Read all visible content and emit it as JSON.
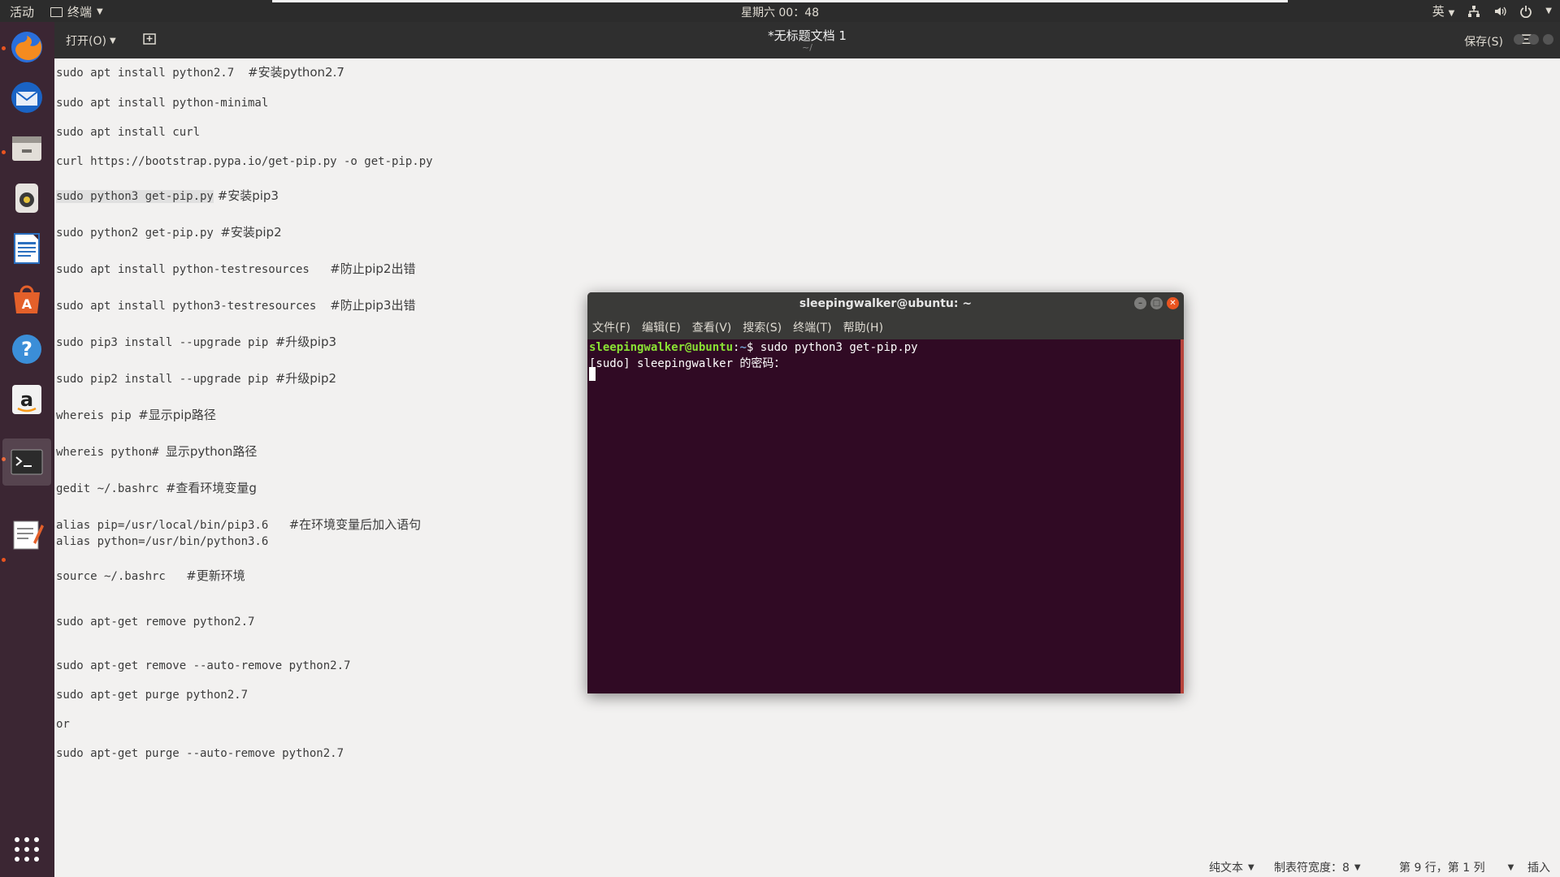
{
  "topbar": {
    "activities": "活动",
    "app_menu": "终端",
    "clock": "星期六 00：48",
    "input_method": "英"
  },
  "gedit": {
    "open_button": "打开(O)",
    "title": "*无标题文档 1",
    "subtitle": "~/",
    "save_button": "保存(S)"
  },
  "editor_lines": [
    {
      "code": "sudo apt install python2.7  ",
      "comment": "#安装python2.7"
    },
    {
      "code": "sudo apt install python-minimal",
      "comment": ""
    },
    {
      "code": "sudo apt install curl",
      "comment": ""
    },
    {
      "code": "curl https://bootstrap.pypa.io/get-pip.py -o get-pip.py",
      "comment": ""
    },
    {
      "code": "sudo python3 get-pip.py",
      "comment": " #安装pip3"
    },
    {
      "code": "sudo python2 get-pip.py ",
      "comment": "#安装pip2"
    },
    {
      "code": "sudo apt install python-testresources   ",
      "comment": "#防止pip2出错"
    },
    {
      "code": "sudo apt install python3-testresources  ",
      "comment": "#防止pip3出错"
    },
    {
      "code": "sudo pip3 install --upgrade pip ",
      "comment": "#升级pip3"
    },
    {
      "code": "sudo pip2 install --upgrade pip ",
      "comment": "#升级pip2"
    },
    {
      "code": "whereis pip ",
      "comment": "#显示pip路径"
    },
    {
      "code": "whereis python# ",
      "comment": "显示python路径"
    },
    {
      "code": "gedit ~/.bashrc ",
      "comment": "#查看环境变量g"
    },
    {
      "code": "alias pip=/usr/local/bin/pip3.6   ",
      "comment": "#在环境变量后加入语句"
    },
    {
      "code": "alias python=/usr/bin/python3.6",
      "comment": ""
    },
    {
      "code": "source ~/.bashrc   ",
      "comment": "#更新环境"
    },
    {
      "code": "sudo apt-get remove python2.7",
      "comment": ""
    },
    {
      "code": "sudo apt-get remove --auto-remove python2.7",
      "comment": ""
    },
    {
      "code": "sudo apt-get purge python2.7",
      "comment": ""
    },
    {
      "code": "or",
      "comment": ""
    },
    {
      "code": "sudo apt-get purge --auto-remove python2.7",
      "comment": ""
    }
  ],
  "statusbar": {
    "language": "纯文本",
    "tab_width": "制表符宽度：8",
    "position": "第 9 行，第 1 列",
    "mode": "插入"
  },
  "terminal": {
    "title": "sleepingwalker@ubuntu: ~",
    "menu": [
      "文件(F)",
      "编辑(E)",
      "查看(V)",
      "搜索(S)",
      "终端(T)",
      "帮助(H)"
    ],
    "prompt_user": "sleepingwalker@ubuntu",
    "prompt_sep": ":",
    "prompt_path": "~",
    "prompt_end": "$ ",
    "command": "sudo python3 get-pip.py",
    "output": "[sudo] sleepingwalker 的密码："
  },
  "dock": {
    "icons": [
      "firefox-icon",
      "thunderbird-icon",
      "files-icon",
      "rhythmbox-icon",
      "writer-icon",
      "software-icon",
      "help-icon",
      "amazon-icon",
      "terminal-icon",
      "text-editor-icon",
      "show-apps-icon"
    ]
  },
  "colors": {
    "terminal_bg": "#300a24",
    "prompt_user": "#8ae234",
    "prompt_path": "#729fcf",
    "accent": "#e95420",
    "dock_bg": "#3b2633"
  }
}
